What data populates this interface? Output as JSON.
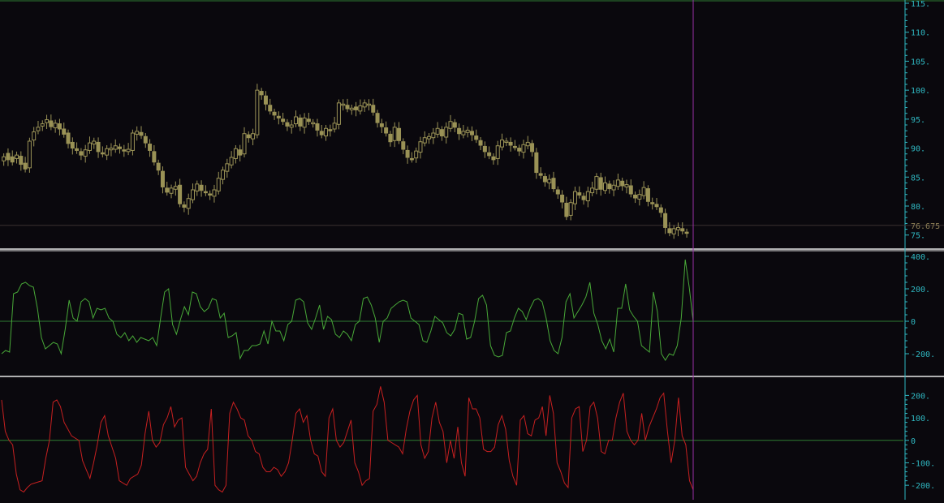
{
  "colors": {
    "background": "#0a080d",
    "candle": "#9a9256",
    "axis": "#2fb8c2",
    "zero_line": "#2e7d32",
    "osc1": "#48a838",
    "osc2": "#c62020",
    "cursor": "#9a2fa8",
    "separator": "#e8e8e8",
    "price_label": "#8d7f57",
    "price_line": "#3a3030"
  },
  "chart_data": [
    {
      "type": "candlestick",
      "name": "price",
      "ylim": [
        73,
        115
      ],
      "yticks": [
        75,
        80,
        85,
        90,
        95,
        100,
        105,
        110,
        115
      ],
      "ytick_labels": [
        "75.",
        "80.",
        "85.",
        "90.",
        "95.",
        "100.",
        "105.",
        "110.",
        "115."
      ],
      "last_value": 76.675,
      "last_value_label": "76.675",
      "close": [
        88.5,
        88.0,
        87.6,
        88.8,
        87.2,
        86.4,
        91.2,
        92.8,
        93.6,
        94.2,
        94.9,
        93.7,
        94.3,
        93.3,
        92.4,
        90.8,
        90.0,
        89.6,
        88.8,
        89.7,
        90.9,
        91.2,
        89.4,
        89.0,
        89.9,
        90.0,
        90.4,
        89.9,
        89.6,
        89.8,
        92.6,
        92.9,
        92.2,
        90.9,
        89.6,
        87.6,
        86.2,
        83.3,
        82.4,
        83.1,
        83.4,
        80.4,
        79.8,
        81.3,
        82.8,
        83.8,
        82.7,
        82.3,
        81.9,
        82.8,
        84.8,
        86.2,
        87.3,
        88.4,
        89.9,
        88.8,
        92.5,
        91.8,
        92.5,
        100.0,
        99.2,
        97.6,
        96.4,
        95.7,
        95.2,
        94.6,
        93.8,
        94.0,
        95.4,
        93.8,
        95.2,
        94.6,
        94.4,
        93.1,
        92.3,
        93.4,
        93.1,
        94.3,
        97.8,
        97.6,
        96.8,
        96.9,
        96.6,
        97.3,
        97.8,
        97.6,
        96.2,
        94.4,
        93.7,
        92.6,
        91.1,
        93.6,
        91.3,
        89.8,
        88.4,
        88.1,
        89.5,
        91.1,
        91.8,
        92.0,
        92.6,
        93.4,
        92.1,
        93.6,
        94.6,
        93.6,
        92.5,
        92.9,
        93.1,
        92.3,
        91.5,
        90.5,
        89.4,
        88.7,
        88.0,
        90.4,
        91.4,
        91.2,
        90.5,
        90.2,
        89.5,
        90.6,
        91.0,
        89.4,
        85.8,
        85.3,
        84.2,
        84.6,
        83.0,
        82.1,
        80.7,
        78.2,
        80.6,
        82.5,
        81.9,
        81.1,
        82.5,
        83.1,
        85.1,
        82.9,
        84.0,
        83.0,
        83.6,
        84.5,
        83.5,
        83.7,
        82.1,
        81.4,
        82.0,
        83.2,
        80.8,
        80.5,
        79.9,
        78.9,
        76.3,
        75.4,
        76.1,
        76.3,
        75.7,
        75.4,
        76.7
      ],
      "open": [
        87.8,
        89.1,
        88.5,
        88.2,
        88.6,
        87.4,
        86.6,
        91.4,
        93.0,
        93.8,
        94.4,
        94.7,
        93.5,
        94.2,
        93.3,
        92.6,
        91.0,
        89.9,
        89.4,
        88.6,
        89.6,
        90.7,
        91.0,
        89.2,
        88.8,
        89.7,
        89.8,
        90.2,
        89.7,
        89.4,
        89.6,
        92.4,
        92.7,
        92.0,
        90.7,
        89.4,
        87.4,
        86.0,
        83.1,
        82.2,
        82.9,
        83.6,
        80.2,
        79.6,
        81.1,
        82.6,
        83.6,
        82.5,
        82.1,
        81.7,
        82.6,
        84.6,
        86.0,
        87.1,
        88.2,
        89.7,
        89.0,
        92.3,
        91.6,
        92.3,
        99.8,
        99.0,
        97.4,
        96.2,
        95.5,
        95.0,
        94.4,
        93.6,
        94.2,
        95.2,
        93.6,
        95.0,
        94.4,
        94.2,
        92.9,
        92.1,
        93.2,
        93.3,
        94.1,
        97.6,
        97.4,
        96.6,
        97.1,
        96.4,
        97.1,
        97.6,
        97.4,
        96.0,
        94.2,
        93.5,
        92.4,
        91.3,
        93.4,
        91.1,
        89.6,
        88.2,
        88.3,
        89.3,
        90.9,
        91.6,
        91.8,
        92.4,
        93.2,
        91.9,
        93.4,
        94.4,
        93.4,
        92.3,
        92.7,
        92.9,
        92.1,
        91.3,
        90.3,
        89.2,
        88.5,
        88.2,
        90.2,
        91.2,
        91.0,
        90.3,
        90.0,
        89.3,
        90.4,
        90.8,
        89.2,
        85.6,
        85.1,
        84.0,
        84.8,
        82.8,
        81.9,
        80.5,
        78.4,
        80.4,
        82.3,
        81.7,
        80.9,
        82.3,
        82.9,
        84.9,
        82.7,
        83.8,
        82.8,
        83.4,
        84.3,
        83.3,
        83.5,
        81.9,
        81.2,
        81.8,
        83.0,
        80.6,
        80.3,
        79.7,
        78.7,
        76.1,
        75.2,
        75.9,
        76.1,
        75.5
      ]
    },
    {
      "type": "line",
      "name": "oscillator-1",
      "ylim": [
        -320,
        420
      ],
      "yticks": [
        400,
        200,
        0,
        -200
      ],
      "ytick_labels": [
        "400.",
        "200.",
        "0",
        "-200."
      ],
      "values": [
        -200,
        -180,
        -190,
        170,
        180,
        230,
        240,
        220,
        210,
        80,
        -100,
        -170,
        -150,
        -130,
        -140,
        -200,
        -50,
        130,
        20,
        0,
        120,
        140,
        120,
        20,
        80,
        70,
        80,
        20,
        0,
        -80,
        -100,
        -70,
        -120,
        -90,
        -130,
        -100,
        -110,
        -120,
        -100,
        -150,
        20,
        180,
        200,
        -20,
        -80,
        10,
        90,
        40,
        180,
        170,
        90,
        60,
        80,
        140,
        130,
        20,
        50,
        -100,
        -90,
        -70,
        -230,
        -180,
        -180,
        -150,
        -150,
        -140,
        -60,
        -140,
        0,
        -60,
        -60,
        -120,
        -20,
        0,
        130,
        140,
        120,
        -10,
        -50,
        20,
        100,
        -50,
        30,
        10,
        -80,
        -100,
        -60,
        -80,
        -120,
        -20,
        0,
        140,
        150,
        100,
        20,
        -130,
        0,
        20,
        80,
        100,
        120,
        130,
        120,
        20,
        0,
        -20,
        -120,
        -130,
        -60,
        30,
        10,
        -10,
        -70,
        -90,
        -50,
        50,
        40,
        -110,
        -100,
        0,
        140,
        160,
        100,
        -150,
        -210,
        -220,
        -210,
        -70,
        -60,
        20,
        80,
        60,
        10,
        80,
        130,
        140,
        120,
        20,
        -120,
        -180,
        -200,
        -100,
        120,
        170,
        20,
        60,
        100,
        150,
        240,
        50,
        -20,
        -120,
        -170,
        -110,
        -190,
        80,
        80,
        230,
        70,
        30,
        0,
        -150,
        -170,
        -190,
        180,
        60,
        -200,
        -240,
        -200,
        -210,
        -150,
        20,
        380,
        210,
        0
      ]
    },
    {
      "type": "line",
      "name": "oscillator-2",
      "ylim": [
        -250,
        270
      ],
      "yticks": [
        200,
        100,
        0,
        -100,
        -200
      ],
      "ytick_labels": [
        "200.",
        "100.",
        "0",
        "-100.",
        "-200."
      ],
      "values": [
        180,
        40,
        0,
        -20,
        -150,
        -220,
        -230,
        -210,
        -195,
        -190,
        -185,
        -180,
        -80,
        0,
        170,
        180,
        150,
        80,
        50,
        20,
        10,
        0,
        -90,
        -130,
        -170,
        -100,
        -20,
        80,
        110,
        20,
        -30,
        -80,
        -180,
        -190,
        -200,
        -170,
        -160,
        -150,
        -110,
        30,
        130,
        0,
        -30,
        -10,
        70,
        100,
        150,
        60,
        90,
        100,
        -120,
        -150,
        -180,
        -160,
        -100,
        -60,
        -40,
        140,
        -200,
        -220,
        -230,
        -200,
        120,
        170,
        140,
        100,
        90,
        20,
        0,
        -50,
        -60,
        -120,
        -140,
        -140,
        -120,
        -130,
        -160,
        -140,
        -100,
        0,
        120,
        140,
        80,
        110,
        0,
        -60,
        -70,
        -140,
        -160,
        100,
        140,
        0,
        -30,
        -10,
        40,
        90,
        -100,
        -140,
        -200,
        -180,
        -170,
        130,
        160,
        240,
        170,
        0,
        -10,
        -20,
        -30,
        -60,
        50,
        130,
        180,
        200,
        -20,
        -80,
        -50,
        100,
        170,
        80,
        40,
        -100,
        0,
        -80,
        60,
        -100,
        -160,
        190,
        140,
        140,
        100,
        -40,
        -50,
        -50,
        -30,
        70,
        110,
        50,
        -90,
        -160,
        -200,
        90,
        110,
        30,
        20,
        90,
        100,
        150,
        20,
        200,
        120,
        -100,
        -140,
        -190,
        -210,
        100,
        140,
        150,
        -50,
        0,
        150,
        170,
        100,
        -50,
        -60,
        0,
        0,
        100,
        170,
        210,
        40,
        0,
        -20,
        0,
        120,
        0,
        60,
        100,
        140,
        190,
        210,
        40,
        -100,
        0,
        190,
        20,
        -20,
        -180,
        -220
      ]
    }
  ]
}
